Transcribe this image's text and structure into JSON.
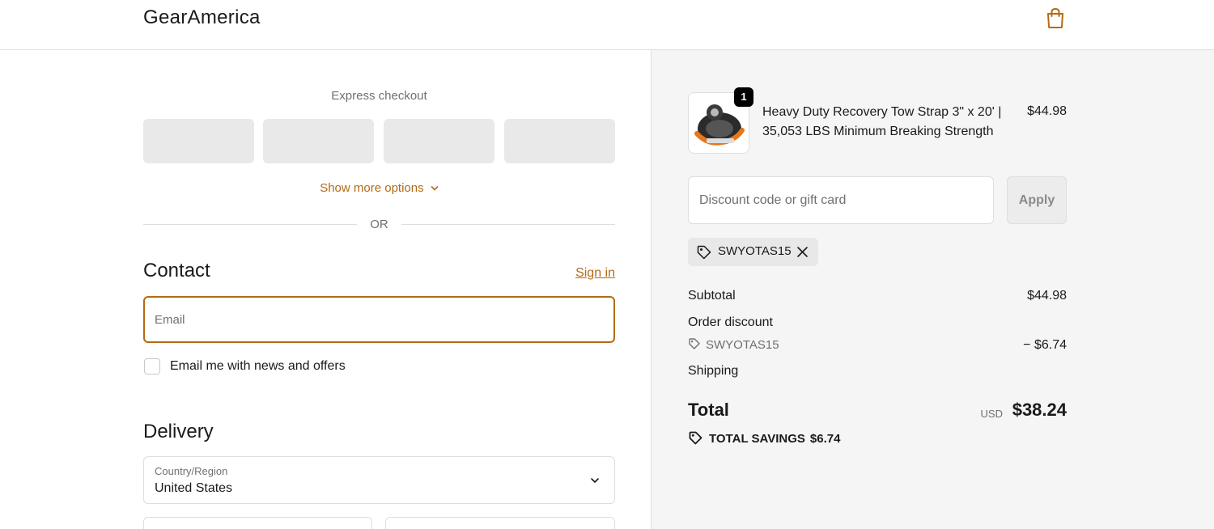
{
  "header": {
    "brand": "GearAmerica",
    "cart_icon": "shopping-bag-icon"
  },
  "colors": {
    "accent": "#b46a13",
    "sidebar_bg": "#f5f5f5",
    "express_placeholder": "#e9e9e9"
  },
  "express": {
    "title": "Express checkout",
    "show_more": "Show more options",
    "or": "OR"
  },
  "contact": {
    "title": "Contact",
    "sign_in": "Sign in",
    "email_placeholder": "Email",
    "newsletter_label": "Email me with news and offers"
  },
  "delivery": {
    "title": "Delivery",
    "country_caption": "Country/Region",
    "country_value": "United States"
  },
  "order": {
    "product_name": "Heavy Duty Recovery Tow Strap 3\" x 20' | 35,053 LBS Minimum Breaking Strength",
    "product_price": "$44.98",
    "quantity": "1",
    "discount_placeholder": "Discount code or gift card",
    "apply_label": "Apply",
    "applied_code": "SWYOTAS15",
    "subtotal_label": "Subtotal",
    "subtotal_value": "$44.98",
    "order_discount_label": "Order discount",
    "discount_code": "SWYOTAS15",
    "discount_value": "− $6.74",
    "shipping_label": "Shipping",
    "total_label": "Total",
    "total_currency": "USD",
    "total_value": "$38.24",
    "savings_label": "TOTAL SAVINGS",
    "savings_value": "$6.74"
  }
}
